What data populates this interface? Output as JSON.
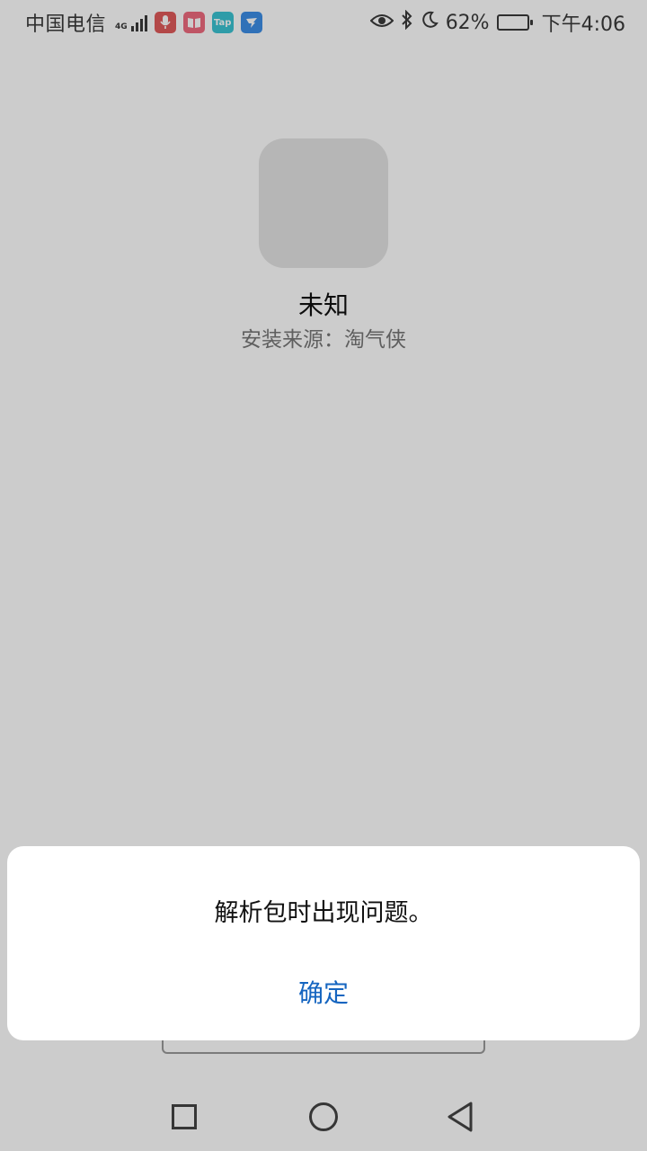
{
  "status_bar": {
    "carrier": "中国电信",
    "network_type": "4G",
    "battery": "62%",
    "time": "下午4:06",
    "icons": [
      "mic-icon",
      "book-icon",
      "tap-icon",
      "dingtalk-icon",
      "eye-icon",
      "bluetooth-icon",
      "moon-icon",
      "battery-icon"
    ],
    "tap_label": "Tap"
  },
  "app_info": {
    "name": "未知",
    "install_source": "安装来源：淘气侠"
  },
  "dialog": {
    "message": "解析包时出现问题。",
    "ok_label": "确定"
  },
  "colors": {
    "accent": "#1565c0",
    "scrim": "rgba(0,0,0,0.2)"
  },
  "nav_bar": {
    "icons": [
      "recent-apps-icon",
      "home-icon",
      "back-icon"
    ]
  }
}
